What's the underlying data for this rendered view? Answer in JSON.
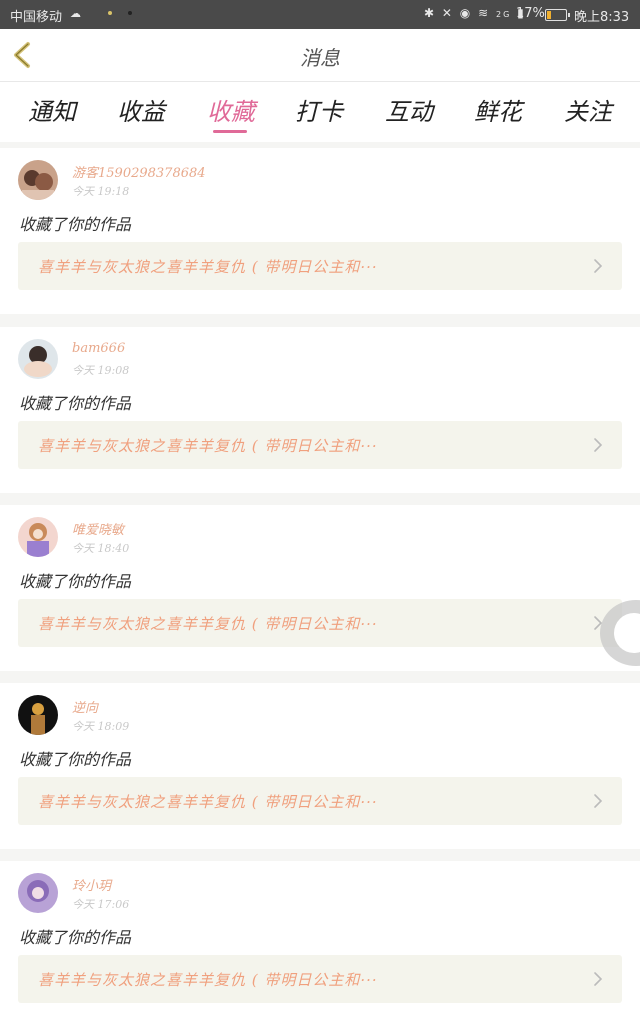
{
  "status_bar": {
    "carrier": "中国移动",
    "battery": "17%",
    "time": "晚上8:33",
    "network": "2G"
  },
  "header": {
    "title": "消息",
    "back_icon": "chevron-left-icon"
  },
  "tabs": [
    {
      "label": "通知",
      "active": false
    },
    {
      "label": "收益",
      "active": false
    },
    {
      "label": "收藏",
      "active": true
    },
    {
      "label": "打卡",
      "active": false
    },
    {
      "label": "互动",
      "active": false
    },
    {
      "label": "鲜花",
      "active": false
    },
    {
      "label": "关注",
      "active": false
    }
  ],
  "messages": [
    {
      "user": "游客1590298378684",
      "time": "今天 19:18",
      "action": "收藏了你的作品",
      "work": "喜羊羊与灰太狼之喜羊羊复仇 ( 带明日公主和···"
    },
    {
      "user": "bam666",
      "time": "今天 19:08",
      "action": "收藏了你的作品",
      "work": "喜羊羊与灰太狼之喜羊羊复仇 ( 带明日公主和···"
    },
    {
      "user": "唯爱晓敏",
      "time": "今天 18:40",
      "action": "收藏了你的作品",
      "work": "喜羊羊与灰太狼之喜羊羊复仇 ( 带明日公主和···"
    },
    {
      "user": "逆向",
      "time": "今天 18:09",
      "action": "收藏了你的作品",
      "work": "喜羊羊与灰太狼之喜羊羊复仇 ( 带明日公主和···"
    },
    {
      "user": "玲小玥",
      "time": "今天 17:06",
      "action": "收藏了你的作品",
      "work": "喜羊羊与灰太狼之喜羊羊复仇 ( 带明日公主和···"
    }
  ],
  "colors": {
    "accent": "#e06a98",
    "username": "#e8a98c",
    "work_title": "#f0a07e"
  }
}
